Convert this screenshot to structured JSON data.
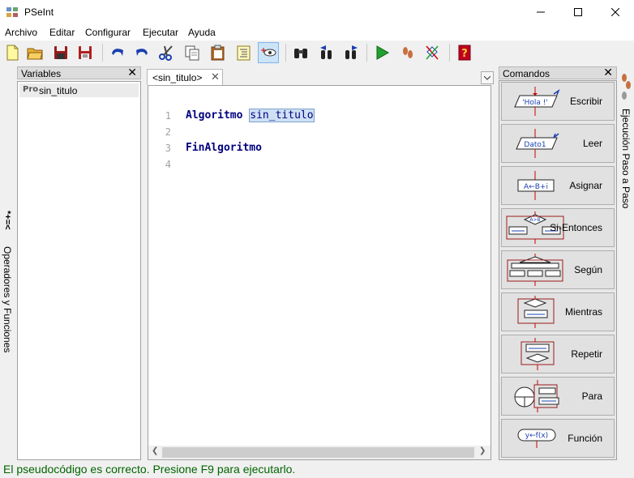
{
  "window": {
    "title": "PSeInt"
  },
  "menu": [
    "Archivo",
    "Editar",
    "Configurar",
    "Ejecutar",
    "Ayuda"
  ],
  "left_strip": {
    "label": "Operadores y Funciones",
    "symbols": "*+=<"
  },
  "variables_panel": {
    "title": "Variables",
    "close": "✕",
    "items": [
      {
        "icon_text": "Pro",
        "label": "sin_titulo"
      }
    ]
  },
  "editor": {
    "tab_label": "<sin_titulo>",
    "tab_close": "✕",
    "lines": [
      {
        "number": "1",
        "keyword": "Algoritmo",
        "name": "sin_titulo"
      },
      {
        "number": "2"
      },
      {
        "number": "3",
        "keyword": "FinAlgoritmo"
      },
      {
        "number": "4"
      }
    ]
  },
  "commands_panel": {
    "title": "Comandos",
    "close": "✕",
    "buttons": [
      {
        "label": "Escribir",
        "icon_text": "'Hola !'"
      },
      {
        "label": "Leer",
        "icon_text": "Dato1"
      },
      {
        "label": "Asignar",
        "icon_text": "A←B+i"
      },
      {
        "label": "Si-Entonces",
        "icon_text": "A>B"
      },
      {
        "label": "Según",
        "icon_text": ""
      },
      {
        "label": "Mientras",
        "icon_text": ""
      },
      {
        "label": "Repetir",
        "icon_text": ""
      },
      {
        "label": "Para",
        "icon_text": ""
      },
      {
        "label": "Función",
        "icon_text": "y←f(x)"
      }
    ]
  },
  "right_strip": {
    "label": "Ejecución Paso a Paso"
  },
  "status": {
    "text": "El pseudocódigo es correcto. Presione F9 para ejecutarlo."
  },
  "colors": {
    "keyword": "#00007f",
    "status": "#006400",
    "accent_red": "#c00000",
    "accent_blue": "#2040c0"
  }
}
